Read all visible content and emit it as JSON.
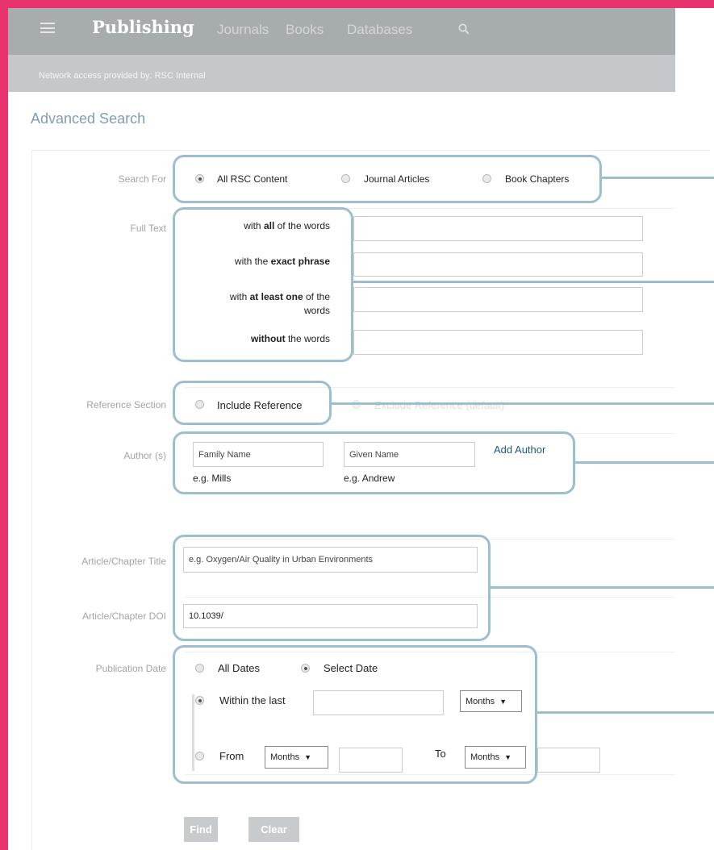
{
  "header": {
    "brand": "Publishing",
    "nav": [
      "Journals",
      "Books",
      "Databases"
    ]
  },
  "network": "Network access provided by: RSC Internal",
  "title": "Advanced Search",
  "search_for": {
    "label": "Search For",
    "options": [
      "All RSC Content",
      "Journal Articles",
      "Book Chapters"
    ],
    "selected": "All RSC Content"
  },
  "full_text": {
    "label": "Full Text",
    "all_pre": "with ",
    "all_b": "all",
    "all_post": " of the words",
    "exact_pre": "with the ",
    "exact_b": "exact phrase",
    "one_pre": "with ",
    "one_b": "at least one",
    "one_post": " of the",
    "one_line2": "words",
    "without_b": "without",
    "without_post": " the words"
  },
  "reference": {
    "label": "Reference Section",
    "include": "Include Reference",
    "exclude": "Exclude Reference (default)"
  },
  "author": {
    "label": "Author (s)",
    "family_placeholder": "Family Name",
    "given_placeholder": "Given Name",
    "add": "Add Author",
    "family_example": "e.g. Mills",
    "given_example": "e.g. Andrew"
  },
  "article": {
    "title_label": "Article/Chapter Title",
    "title_placeholder": "e.g. Oxygen/Air Quality in Urban Environments",
    "doi_label": "Article/Chapter DOI",
    "doi_value": "10.1039/"
  },
  "pubdate": {
    "label": "Publication Date",
    "all_dates": "All Dates",
    "select_date": "Select Date",
    "within": "Within the last",
    "months": "Months",
    "from": "From",
    "to": "To"
  },
  "buttons": {
    "find": "Find",
    "clear": "Clear"
  },
  "colors": {
    "accent": "#e8336f",
    "annotation": "#9bbfce",
    "header": "#a7adaf"
  }
}
